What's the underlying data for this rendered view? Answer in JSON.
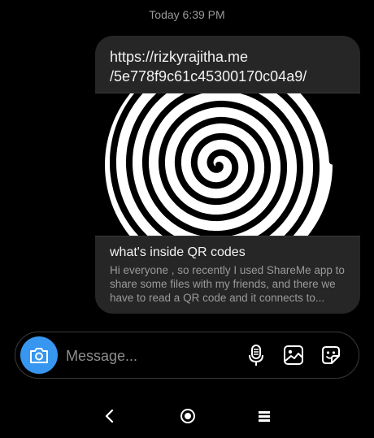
{
  "thread": {
    "timestamp": "Today 6:39 PM"
  },
  "message": {
    "link_url": "https://rizkyrajitha.me\n/5e778f9c61c45300170c04a9/",
    "preview_title": "what's inside QR codes",
    "preview_description": "Hi everyone , so recently I used ShareMe app to share some files with my friends, and there we have to read a QR code and it connects to..."
  },
  "composer": {
    "placeholder": "Message...",
    "icons": [
      "camera-icon",
      "microphone-icon",
      "image-icon",
      "sticker-icon"
    ]
  },
  "navbar": {
    "icons": [
      "back-icon",
      "home-icon",
      "recent-apps-icon"
    ]
  },
  "colors": {
    "background": "#000000",
    "bubble": "#262626",
    "accent": "#3797f0",
    "muted_text": "#9a9a9a"
  }
}
